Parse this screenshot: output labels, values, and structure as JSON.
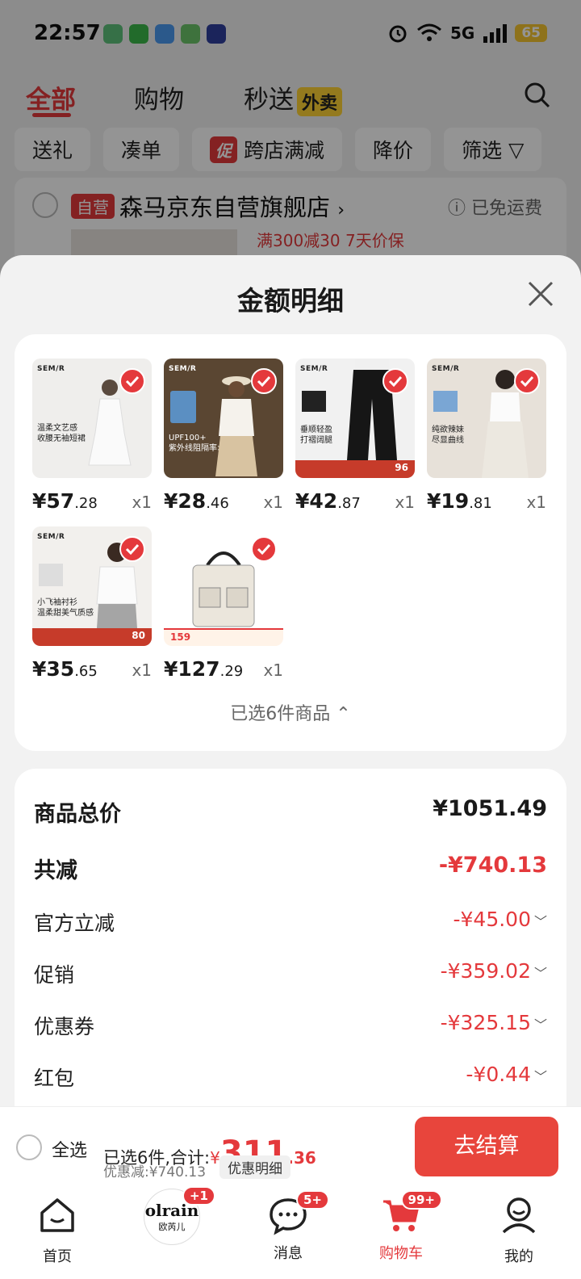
{
  "status_bar": {
    "time": "22:57",
    "battery": "65",
    "network": "5G"
  },
  "top_nav": {
    "tabs": [
      "全部",
      "购物",
      "秒送"
    ],
    "waimai_badge": "外卖"
  },
  "filter_chips": [
    "送礼",
    "凑单",
    "跨店满减",
    "降价",
    "筛选"
  ],
  "promo_chip_badge": "促",
  "store": {
    "tag": "自营",
    "name": "森马京东自营旗舰店",
    "shipping": "已免运费",
    "promos": "满300减30   7天价保"
  },
  "sheet": {
    "title": "金额明细",
    "items": [
      {
        "price_int": "¥57",
        "price_dec": ".28",
        "qty": "x1",
        "brand": "SEM/R",
        "caption": "温柔文艺感\n收腰无袖短裙",
        "thumb_bg": "#efeeec"
      },
      {
        "price_int": "¥28",
        "price_dec": ".46",
        "qty": "x1",
        "brand": "SEM/R",
        "caption": "UPF100+\n紫外线阻隔率>95%",
        "thumb_bg": "#5a4632"
      },
      {
        "price_int": "¥42",
        "price_dec": ".87",
        "qty": "x1",
        "brand": "SEM/R",
        "caption": "垂顺轻盈\n打褶阔腿",
        "thumb_bg": "#f1f1f1",
        "band": "96"
      },
      {
        "price_int": "¥19",
        "price_dec": ".81",
        "qty": "x1",
        "brand": "SEM/R",
        "caption": "纯欲辣妹\n尽显曲线",
        "thumb_bg": "#e7e1d9"
      },
      {
        "price_int": "¥35",
        "price_dec": ".65",
        "qty": "x1",
        "brand": "SEM/R",
        "caption": "小飞袖衬衫\n温柔甜美气质感",
        "thumb_bg": "#f2f0ed",
        "band": "80"
      },
      {
        "price_int": "¥127",
        "price_dec": ".29",
        "qty": "x1",
        "brand": "",
        "caption": "",
        "thumb_bg": "#ffffff",
        "band": "159"
      }
    ],
    "selected_toggle": "已选6件商品 ⌃",
    "summary": {
      "total_label": "商品总价",
      "total_value": "¥1051.49",
      "reduce_label": "共减",
      "reduce_value": "-¥740.13",
      "rows": [
        {
          "label": "官方立减",
          "value": "-¥45.00"
        },
        {
          "label": "促销",
          "value": "-¥359.02"
        },
        {
          "label": "优惠券",
          "value": "-¥325.15"
        },
        {
          "label": "红包",
          "value": "-¥0.44"
        }
      ]
    }
  },
  "checkout": {
    "select_all": "全选",
    "selected_prefix": "已选6件,合计:",
    "yen": "¥",
    "total_int": "311",
    "total_dec": ".36",
    "discount": "优惠减:¥740.13",
    "detail_button": "优惠明细",
    "go_button": "去结算"
  },
  "tabbar": {
    "tabs": [
      {
        "label": "首页"
      },
      {
        "label": "",
        "logo_top": "olrain",
        "logo_bottom": "欧芮儿",
        "badge": "+1"
      },
      {
        "label": "消息",
        "badge": "5+"
      },
      {
        "label": "购物车",
        "badge": "99+"
      },
      {
        "label": "我的"
      }
    ]
  },
  "colors": {
    "accent": "#e4393c",
    "sheet_bg": "#f2f2f2",
    "waimai": "#ffd234"
  }
}
